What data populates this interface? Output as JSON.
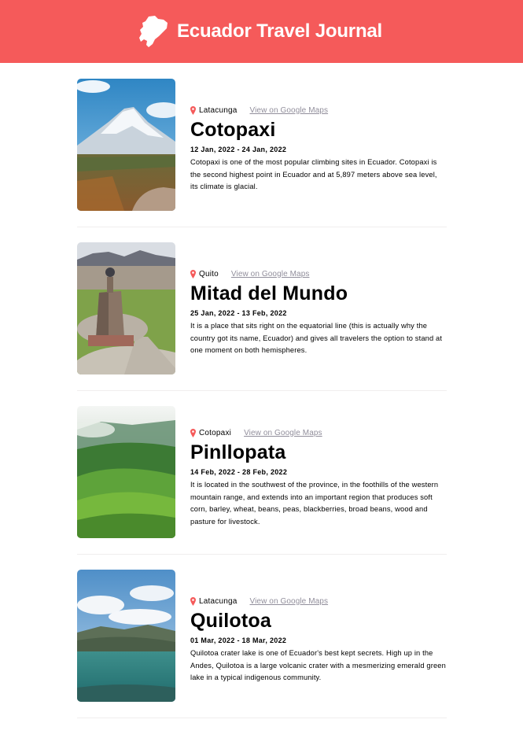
{
  "header": {
    "title": "Ecuador Travel Journal"
  },
  "entries": [
    {
      "location": "Latacunga",
      "maps_link": "View on Google Maps",
      "title": "Cotopaxi",
      "dates": "12 Jan, 2022 - 24 Jan, 2022",
      "description": "Cotopaxi is one of the most popular climbing sites in Ecuador. Cotopaxi is the second highest point in Ecuador and at 5,897 meters above sea level, its climate is glacial."
    },
    {
      "location": "Quito",
      "maps_link": "View on Google Maps",
      "title": "Mitad del Mundo",
      "dates": "25 Jan, 2022 - 13 Feb, 2022",
      "description": "It is a place that sits right on the equatorial line (this is actually why the country got its name, Ecuador) and gives all travelers the option to stand at one moment on both hemispheres."
    },
    {
      "location": "Cotopaxi",
      "maps_link": "View on Google Maps",
      "title": "Pinllopata",
      "dates": "14 Feb, 2022 - 28 Feb, 2022",
      "description": "It is located in the southwest of the province, in the foothills of the western mountain range, and extends into an important region that produces soft corn, barley, wheat, beans, peas, blackberries, broad beans, wood and pasture for livestock."
    },
    {
      "location": "Latacunga",
      "maps_link": "View on Google Maps",
      "title": "Quilotoa",
      "dates": "01 Mar, 2022 - 18 Mar, 2022",
      "description": "Quilotoa crater lake is one of Ecuador's best kept secrets. High up in the Andes, Quilotoa is a large volcanic crater with a mesmerizing emerald green lake in a typical indigenous community."
    }
  ],
  "colors": {
    "brand": "#f55a5a",
    "link": "#918e9b",
    "divider": "#f0eeee"
  }
}
